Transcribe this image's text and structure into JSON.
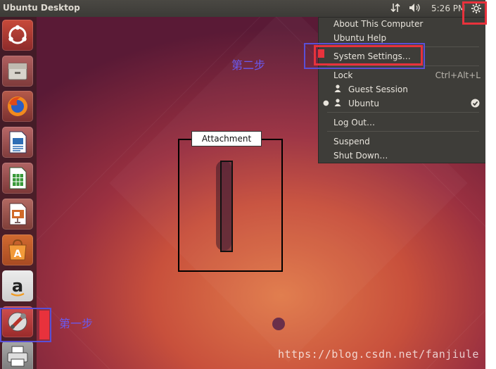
{
  "topbar": {
    "title": "Ubuntu Desktop",
    "network_icon": "network-updown-icon",
    "volume_icon": "volume-icon",
    "clock": "5:26 PM",
    "gear_icon": "gear-icon"
  },
  "launcher": {
    "items": [
      {
        "name": "ubuntu-dash-icon"
      },
      {
        "name": "files-icon"
      },
      {
        "name": "firefox-icon"
      },
      {
        "name": "writer-icon"
      },
      {
        "name": "calc-icon"
      },
      {
        "name": "impress-icon"
      },
      {
        "name": "software-center-icon"
      },
      {
        "name": "amazon-icon",
        "glyph": "a"
      },
      {
        "name": "system-settings-icon"
      },
      {
        "name": "printer-icon"
      }
    ]
  },
  "menu": {
    "about": "About This Computer",
    "help": "Ubuntu Help",
    "system_settings": "System Settings…",
    "lock": "Lock",
    "lock_shortcut": "Ctrl+Alt+L",
    "guest": "Guest Session",
    "user": "Ubuntu",
    "logout": "Log Out…",
    "suspend": "Suspend",
    "shutdown": "Shut Down…"
  },
  "annotations": {
    "step1": "第一步",
    "step2": "第二步",
    "attachment": "Attachment"
  },
  "watermark": "https://blog.csdn.net/fanjiule",
  "colors": {
    "panel": "#3c3b37",
    "highlight": "#e8323c",
    "annotation_blue": "#6a5af0"
  }
}
